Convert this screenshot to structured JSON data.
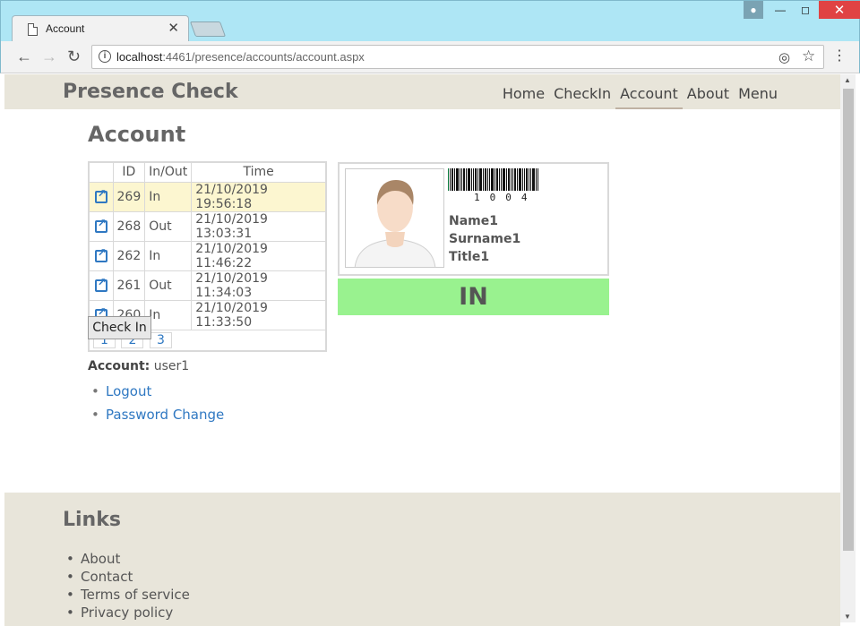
{
  "browser": {
    "tab_title": "Account",
    "close_glyph": "✕",
    "url_host": "localhost",
    "url_rest": ":4461/presence/accounts/account.aspx"
  },
  "site": {
    "brand": "Presence Check",
    "nav": [
      "Home",
      "CheckIn",
      "Account",
      "About",
      "Menu"
    ],
    "active_nav": "Account"
  },
  "main": {
    "title": "Account",
    "grid": {
      "headers": [
        "",
        "ID",
        "In/Out",
        "Time"
      ],
      "rows": [
        {
          "id": "269",
          "io": "In",
          "time": "21/10/2019 19:56:18",
          "selected": true
        },
        {
          "id": "268",
          "io": "Out",
          "time": "21/10/2019 13:03:31"
        },
        {
          "id": "262",
          "io": "In",
          "time": "21/10/2019 11:46:22"
        },
        {
          "id": "261",
          "io": "Out",
          "time": "21/10/2019 11:34:03"
        },
        {
          "id": "260",
          "io": "In",
          "time": "21/10/2019 11:33:50"
        }
      ],
      "pages": [
        "1",
        "2",
        "3"
      ]
    },
    "checkin_button": "Check In",
    "card": {
      "barcode_text": "1004",
      "name": "Name1",
      "surname": "Surname1",
      "title": "Title1"
    },
    "status": "IN",
    "status_color": "#99f28f",
    "account_label": "Account:",
    "account_value": "user1",
    "links": [
      "Logout",
      "Password Change"
    ]
  },
  "footer": {
    "title": "Links",
    "links": [
      "About",
      "Contact",
      "Terms of service",
      "Privacy policy"
    ]
  }
}
